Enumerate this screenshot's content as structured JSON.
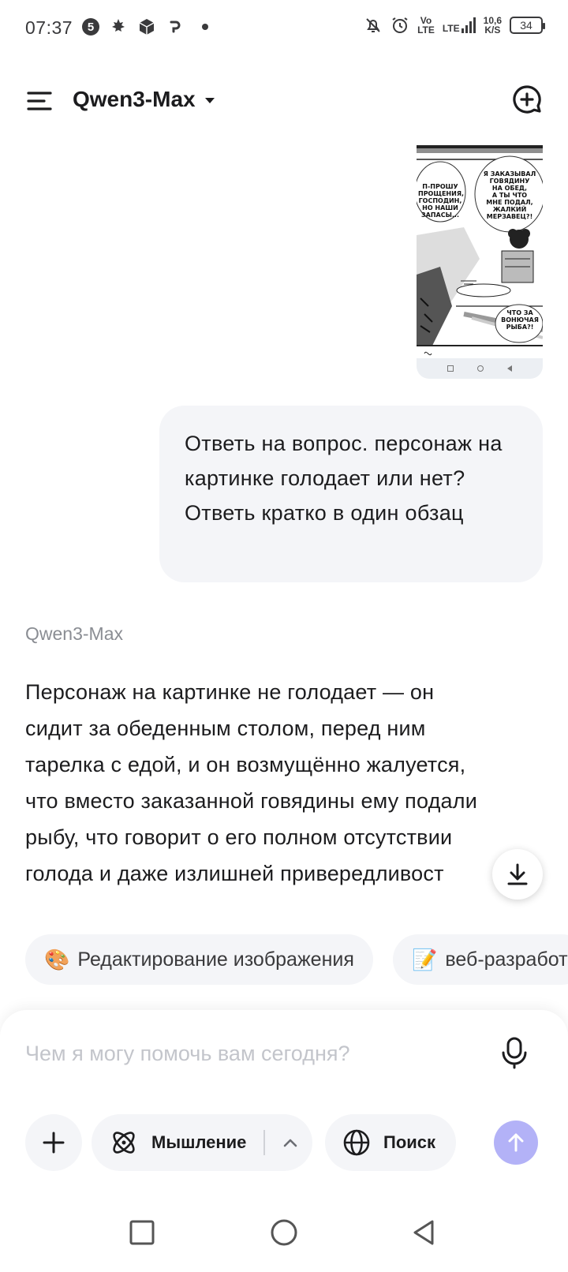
{
  "status_bar": {
    "time": "07:37",
    "badge": "5",
    "volte": [
      "Vo",
      "LTE"
    ],
    "lte": "LTE",
    "speed_value": "10,6",
    "speed_unit": "K/S",
    "battery": "34"
  },
  "header": {
    "model_name": "Qwen3-Max"
  },
  "manga": {
    "bubble_left": "П-ПРОШУ\nПРОЩЕНИЯ,\nГОСПОДИН,\nНО НАШИ\nЗАПАСЫ...",
    "bubble_right": "Я ЗАКАЗЫВАЛ\nГОВЯДИНУ\nНА ОБЕД,\nА ТЫ ЧТО\nМНЕ ПОДАЛ,\nЖАЛКИЙ\nМЕРЗАВЕЦ?!",
    "bubble_bottom": "ЧТО ЗА\nВОНЮЧАЯ\nРЫБА?!"
  },
  "user_message": {
    "text": "Ответь на вопрос. персонаж на картинке голодает или нет? Ответь кратко в один обзац"
  },
  "assistant": {
    "label": "Qwen3-Max",
    "text": "Персонаж на картинке не голодает — он\nсидит за обеденным столом, перед ним\nтарелка с едой, и он возмущённо жалуется,\nчто вместо заказанной говядины ему подали\nрыбу, что говорит о его полном отсутствии\nголода и даже излишней привередливост"
  },
  "suggestions": [
    {
      "emoji": "🎨",
      "label": "Редактирование изображения"
    },
    {
      "emoji": "📝",
      "label": "веб-разработ"
    }
  ],
  "input": {
    "placeholder": "Чем я могу помочь вам сегодня?"
  },
  "tools": {
    "thinking_label": "Мышление",
    "search_label": "Поиск"
  },
  "colors": {
    "send_button": "#b3b2f7",
    "bubble_bg": "#f4f5f8",
    "muted_text": "#8a8d93"
  }
}
